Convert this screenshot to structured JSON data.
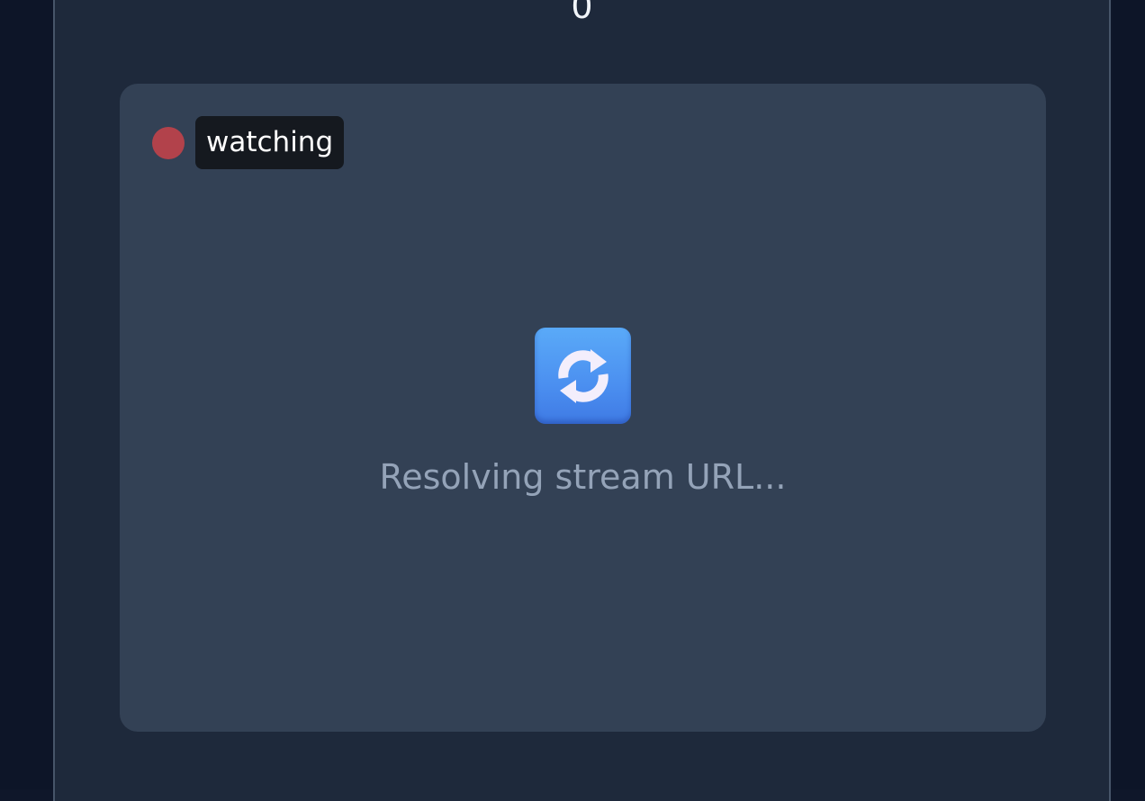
{
  "counter": {
    "value": "0"
  },
  "stream_card": {
    "status": {
      "dot_color": "#b2424b",
      "label": "watching"
    },
    "loading": {
      "icon": "refresh-icon",
      "message": "Resolving stream URL..."
    }
  }
}
